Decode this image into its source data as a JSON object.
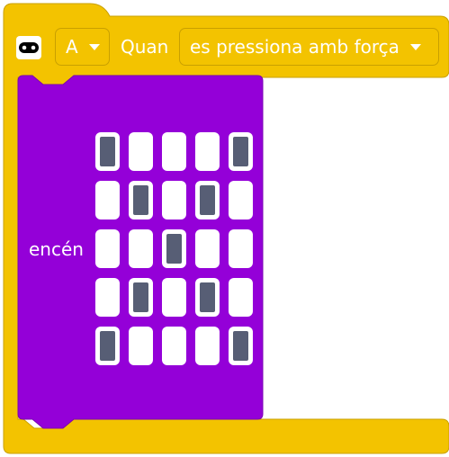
{
  "hat_block": {
    "icon": "microbit-icon",
    "color": "#f3c300",
    "button_value": "A",
    "label": "Quan",
    "gesture_value": "es pressiona amb força"
  },
  "statement_block": {
    "color": "#9400d8",
    "label": "encén",
    "led_matrix": [
      [
        true,
        false,
        false,
        false,
        true
      ],
      [
        false,
        true,
        false,
        true,
        false
      ],
      [
        false,
        false,
        true,
        false,
        false
      ],
      [
        false,
        true,
        false,
        true,
        false
      ],
      [
        true,
        false,
        false,
        false,
        true
      ]
    ],
    "led_on_color": "#575e75",
    "led_off_color": "#ffffff"
  }
}
